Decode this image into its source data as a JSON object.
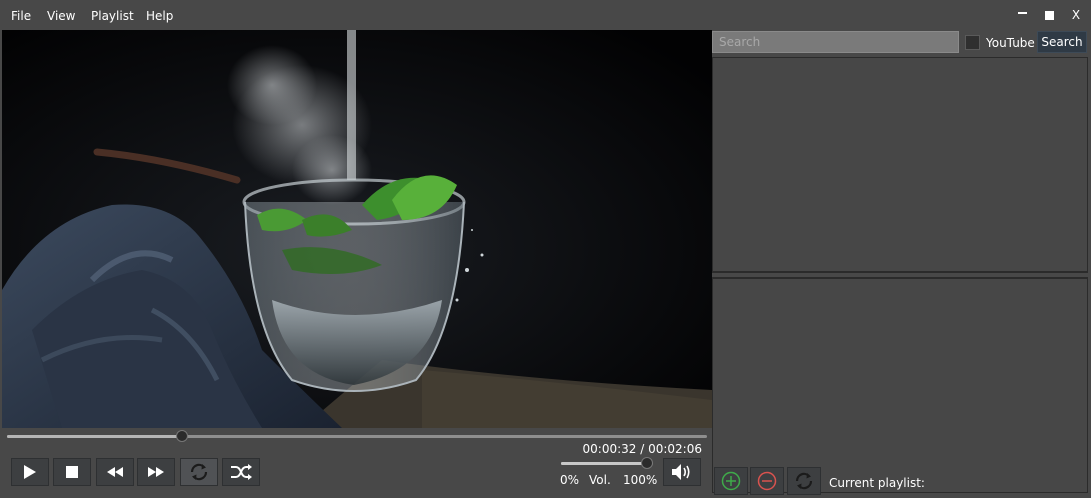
{
  "menu": {
    "file": "File",
    "view": "View",
    "playlist": "Playlist",
    "help": "Help"
  },
  "window_controls": {
    "minimize": "–",
    "maximize": "■",
    "close": "X"
  },
  "player": {
    "progress_fraction": 0.25,
    "time": "00:00:32 / 00:02:06",
    "volume": {
      "fraction": 1.0,
      "min_label": "0%",
      "label": "Vol.",
      "max_label": "100%"
    },
    "buttons": [
      "play-icon",
      "stop-icon",
      "rewind-icon",
      "fast-forward-icon",
      "repeat-icon",
      "shuffle-icon",
      "speaker-icon"
    ]
  },
  "search": {
    "placeholder": "Search",
    "value": "",
    "youtube_label": "YouTube",
    "youtube_checked": false,
    "button_label": "Search"
  },
  "playlist": {
    "current_label": "Current playlist:",
    "buttons": [
      "add-icon",
      "remove-icon",
      "refresh-icon"
    ],
    "add_color": "#3faa4a",
    "remove_color": "#d9534f"
  }
}
